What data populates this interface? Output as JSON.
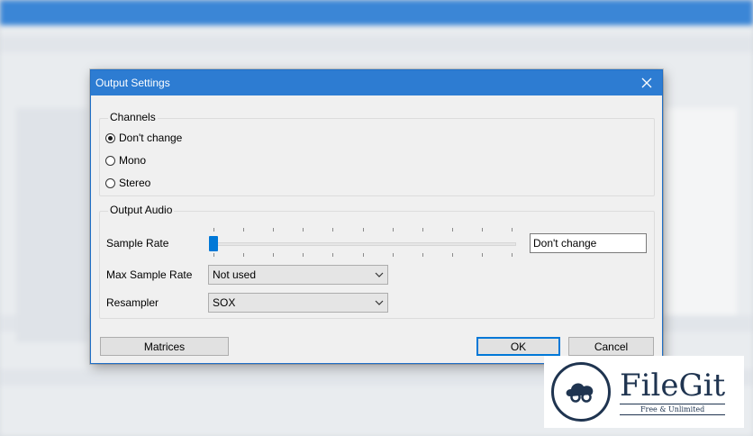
{
  "dialog": {
    "title": "Output Settings",
    "close_icon": "close-icon"
  },
  "channels": {
    "group_title": "Channels",
    "options": [
      {
        "label": "Don't change",
        "checked": true
      },
      {
        "label": "Mono",
        "checked": false
      },
      {
        "label": "Stereo",
        "checked": false
      }
    ]
  },
  "output_audio": {
    "group_title": "Output Audio",
    "sample_rate_label": "Sample Rate",
    "sample_rate_slider_position": 0,
    "sample_rate_value": "Don't change",
    "max_sample_rate_label": "Max Sample Rate",
    "max_sample_rate_value": "Not used",
    "resampler_label": "Resampler",
    "resampler_value": "SOX"
  },
  "buttons": {
    "matrices": "Matrices",
    "ok": "OK",
    "cancel": "Cancel"
  },
  "watermark": {
    "title": "FileGit",
    "subtitle": "Free & Unlimited"
  },
  "colors": {
    "accent": "#0078d7",
    "titlebar": "#2d7cd2"
  }
}
